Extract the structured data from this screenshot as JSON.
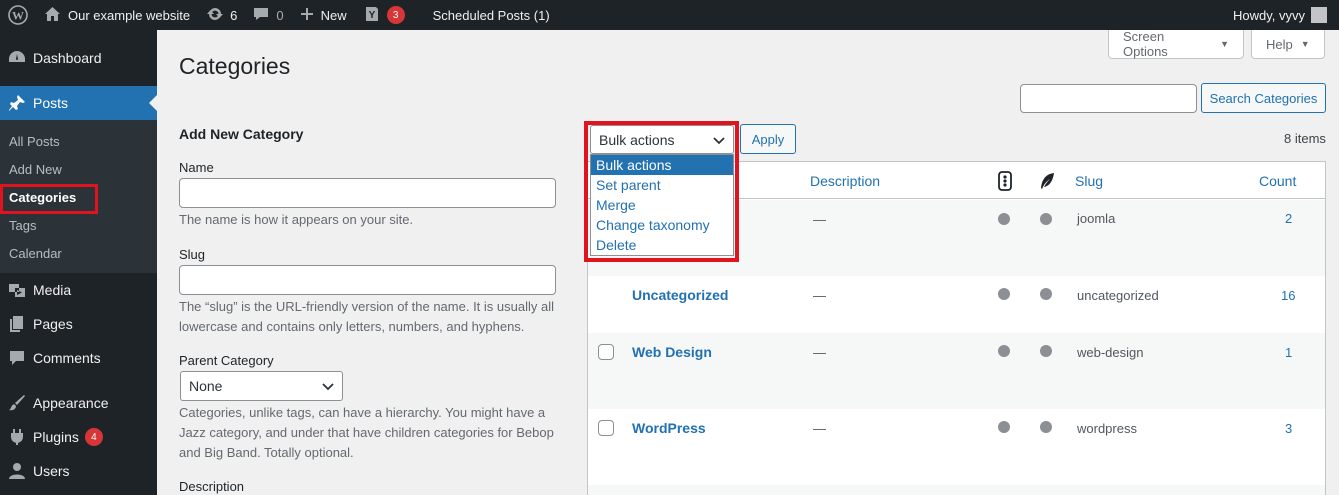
{
  "admin_bar": {
    "site_name": "Our example website",
    "updates_count": "6",
    "comments_count": "0",
    "new_label": "New",
    "seo_badge": "3",
    "scheduled": "Scheduled Posts (1)",
    "greeting": "Howdy, vyvy"
  },
  "sidebar": {
    "dashboard": "Dashboard",
    "posts": "Posts",
    "sub_items": [
      "All Posts",
      "Add New",
      "Categories",
      "Tags",
      "Calendar"
    ],
    "media": "Media",
    "pages": "Pages",
    "comments": "Comments",
    "appearance": "Appearance",
    "plugins": "Plugins",
    "plugins_badge": "4",
    "users": "Users"
  },
  "header": {
    "title": "Categories",
    "screen_options": "Screen Options",
    "help": "Help"
  },
  "form": {
    "title": "Add New Category",
    "name_label": "Name",
    "name_value": "",
    "name_desc": "The name is how it appears on your site.",
    "slug_label": "Slug",
    "slug_value": "",
    "slug_desc": "The “slug” is the URL-friendly version of the name. It is usually all lowercase and contains only letters, numbers, and hyphens.",
    "parent_label": "Parent Category",
    "parent_value": "None",
    "parent_desc": "Categories, unlike tags, can have a hierarchy. You might have a Jazz category, and under that have children categories for Bebop and Big Band. Totally optional.",
    "description_label": "Description"
  },
  "list": {
    "search_value": "",
    "search_button": "Search Categories",
    "bulk_selected": "Bulk actions",
    "bulk_options": [
      "Bulk actions",
      "Set parent",
      "Merge",
      "Change taxonomy",
      "Delete"
    ],
    "apply": "Apply",
    "items_count": "8 items",
    "columns": {
      "description": "Description",
      "slug": "Slug",
      "count": "Count"
    },
    "rows": [
      {
        "name": "",
        "description": "—",
        "slug": "joomla",
        "count": "2"
      },
      {
        "name": "Uncategorized",
        "description": "—",
        "slug": "uncategorized",
        "count": "16"
      },
      {
        "name": "Web Design",
        "description": "—",
        "slug": "web-design",
        "count": "1"
      },
      {
        "name": "WordPress",
        "description": "—",
        "slug": "wordpress",
        "count": "3"
      }
    ]
  },
  "colors": {
    "accent": "#2271b1",
    "sidebar": "#1d2327",
    "highlight": "#e0141e",
    "badge": "#d63638"
  }
}
